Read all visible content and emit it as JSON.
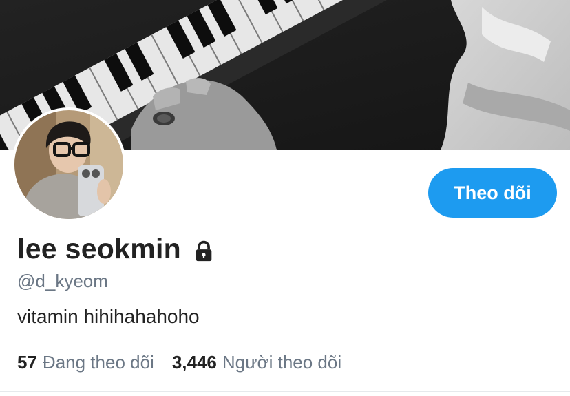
{
  "profile": {
    "display_name": "lee seokmin",
    "handle": "@d_kyeom",
    "bio": "vitamin hihihahahoho",
    "protected_icon": "lock-icon"
  },
  "actions": {
    "follow_label": "Theo dõi"
  },
  "stats": {
    "following_count": "57",
    "following_label": "Đang theo dõi",
    "followers_count": "3,446",
    "followers_label": "Người theo dõi"
  },
  "colors": {
    "accent": "#1d9bf0",
    "text_primary": "#222222",
    "text_secondary": "#6b7785"
  }
}
